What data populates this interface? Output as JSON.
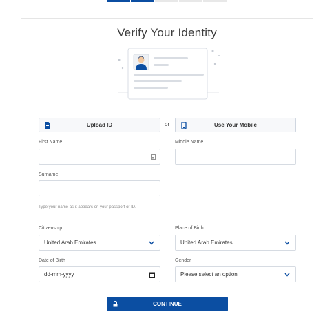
{
  "progress": {
    "total_steps": 5,
    "completed_steps": 2
  },
  "page_title": "Verify Your Identity",
  "methods": {
    "upload_label": "Upload ID",
    "or_text": "or",
    "mobile_label": "Use Your Mobile"
  },
  "form": {
    "first_name": {
      "label": "First Name",
      "value": ""
    },
    "middle_name": {
      "label": "Middle Name",
      "value": ""
    },
    "surname": {
      "label": "Surname",
      "value": ""
    },
    "name_hint": "Type your name as it appears on your passport or ID.",
    "citizenship": {
      "label": "Citizenship",
      "value": "United Arab Emirates"
    },
    "place_of_birth": {
      "label": "Place of Birth",
      "value": "United Arab Emirates"
    },
    "date_of_birth": {
      "label": "Date of Birth",
      "value": "dd-mm-yyyy"
    },
    "gender": {
      "label": "Gender",
      "value": "Please select an option"
    }
  },
  "continue_label": "CONTINUE",
  "colors": {
    "primary": "#0b4ea2",
    "border": "#d6dbe2",
    "text": "#333333"
  },
  "icons": {
    "upload": "id-card-icon",
    "mobile": "mobile-phone-icon",
    "continue": "lock-icon",
    "select": "chevron-down-icon",
    "date": "calendar-icon",
    "autofill": "contact-card-icon"
  }
}
